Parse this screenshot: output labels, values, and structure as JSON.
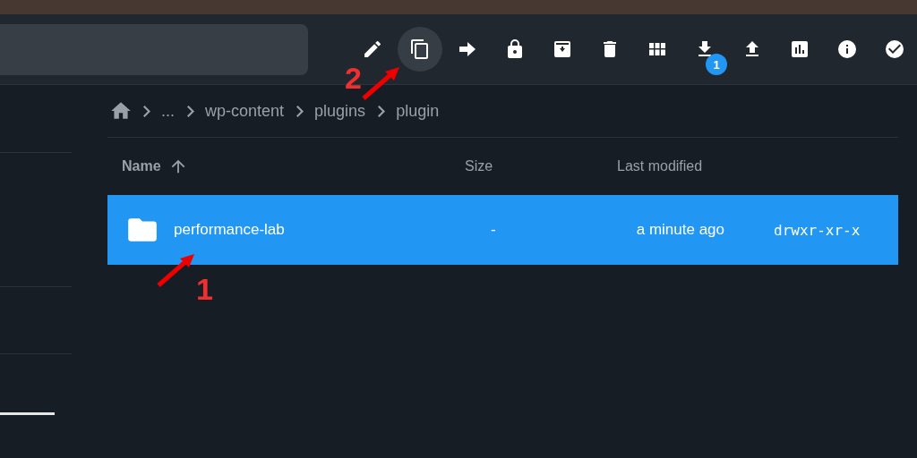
{
  "toolbar": [
    {
      "kind": "edit",
      "hovered": false
    },
    {
      "kind": "copy",
      "hovered": true
    },
    {
      "kind": "move",
      "hovered": false
    },
    {
      "kind": "lock",
      "hovered": false
    },
    {
      "kind": "archive",
      "hovered": false
    },
    {
      "kind": "delete",
      "hovered": false
    },
    {
      "kind": "grid",
      "hovered": false
    },
    {
      "kind": "download",
      "hovered": false,
      "badge": "1"
    },
    {
      "kind": "upload",
      "hovered": false
    },
    {
      "kind": "chart",
      "hovered": false
    },
    {
      "kind": "info",
      "hovered": false
    },
    {
      "kind": "check",
      "hovered": false
    }
  ],
  "breadcrumb": [
    "...",
    "wp-content",
    "plugins",
    "plugin"
  ],
  "table": {
    "columns": [
      {
        "label": "Name",
        "sorted": true
      },
      {
        "label": "Size",
        "sorted": false
      },
      {
        "label": "Last modified",
        "sorted": false
      }
    ],
    "rows": [
      {
        "name": "performance-lab",
        "size": "-",
        "modified": "a minute ago",
        "permissions": "drwxr-xr-x",
        "selected": true
      }
    ]
  },
  "annotations": [
    {
      "label": "2"
    },
    {
      "label": "1"
    }
  ]
}
